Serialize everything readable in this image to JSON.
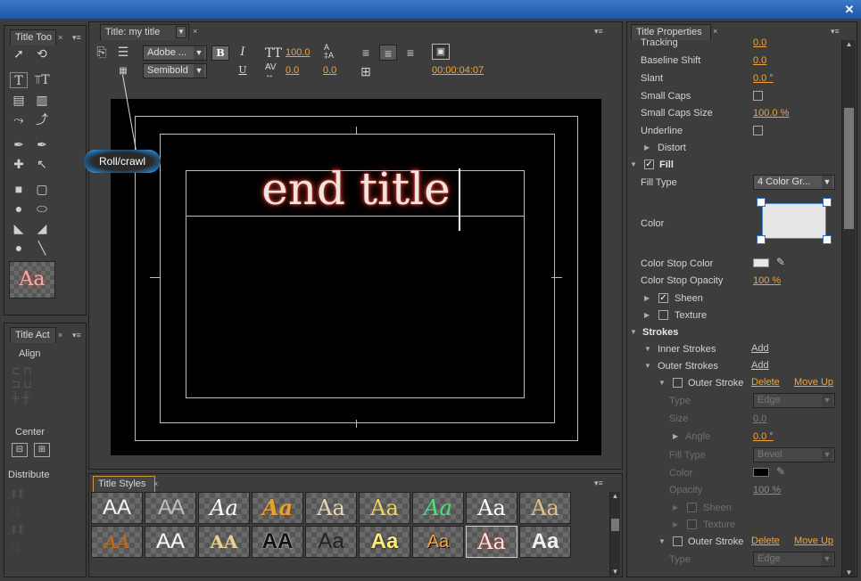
{
  "titlebar": {
    "close_icon": "close-icon"
  },
  "tools_panel": {
    "tab_label": "Title Too",
    "sample_text": "Aa"
  },
  "actions_panel": {
    "tab_label": "Title Act",
    "align_label": "Align",
    "center_label": "Center",
    "distribute_label": "Distribute"
  },
  "title_panel": {
    "tab_label": "Title: my title",
    "font_family": "Adobe ...",
    "font_style": "Semibold",
    "bold_label": "B",
    "italic_label": "I",
    "underline_label": "U",
    "font_size": "100.0",
    "kerning": "0.0",
    "leading": "0.0",
    "timecode": "00:00:04:07",
    "tooltip": "Roll/crawl",
    "canvas_text": "end title"
  },
  "styles_panel": {
    "tab_label": "Title Styles",
    "row1": [
      "AA",
      "AA",
      "Aa",
      "Aa",
      "Aa",
      "Aa",
      "Aa",
      "Aa",
      "Aa"
    ],
    "row2": [
      "AA",
      "AA",
      "AA",
      "AA",
      "Aa",
      "Aa",
      "Aa",
      "Aa",
      "Aa"
    ]
  },
  "properties_panel": {
    "tab_label": "Title Properties",
    "tracking_label": "Tracking",
    "tracking_value": "0.0",
    "baseline_label": "Baseline Shift",
    "baseline_value": "0.0",
    "slant_label": "Slant",
    "slant_value": "0.0 °",
    "smallcaps_label": "Small Caps",
    "smallcaps_size_label": "Small Caps Size",
    "smallcaps_size_value": "100.0 %",
    "underline_label": "Underline",
    "distort_label": "Distort",
    "fill_label": "Fill",
    "fill_type_label": "Fill Type",
    "fill_type_value": "4 Color Gr...",
    "color_label": "Color",
    "color_stop_color_label": "Color Stop Color",
    "color_stop_opacity_label": "Color Stop Opacity",
    "color_stop_opacity_value": "100 %",
    "sheen_label": "Sheen",
    "texture_label": "Texture",
    "strokes_label": "Strokes",
    "inner_strokes_label": "Inner Strokes",
    "inner_add": "Add",
    "outer_strokes_label": "Outer Strokes",
    "outer_add": "Add",
    "outer_stroke_label": "Outer Stroke",
    "delete_label": "Delete",
    "moveup_label": "Move Up",
    "type_label": "Type",
    "type_value": "Edge",
    "size_label": "Size",
    "size_value": "0.0",
    "angle_label": "Angle",
    "angle_value": "0.0 °",
    "filltype2_label": "Fill Type",
    "filltype2_value": "Bevel",
    "color2_label": "Color",
    "opacity_label": "Opacity",
    "opacity_value": "100 %",
    "sheen2_label": "Sheen",
    "texture2_label": "Texture",
    "outer_stroke2_label": "Outer Stroke",
    "delete2_label": "Delete",
    "moveup2_label": "Move Up",
    "type2_label": "Type",
    "type2_value": "Edge"
  },
  "colors": {
    "accent": "#f2a43a",
    "titlebar": "#2f6bbd",
    "glow": "#c0392b"
  }
}
